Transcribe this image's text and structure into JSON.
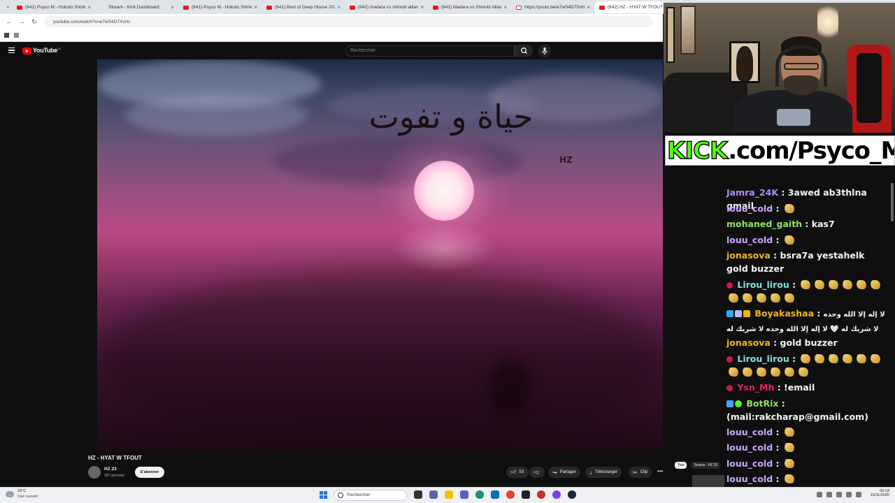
{
  "browser": {
    "tabs": [
      {
        "label": "(642) Psyco M - Hokuto Shinken",
        "icon": "youtube-icon"
      },
      {
        "label": "Stream - Kick Dashboard",
        "icon": "kick-icon"
      },
      {
        "label": "(641) Psyco M - Hokuto Shinken",
        "icon": "youtube-icon"
      },
      {
        "label": "(641) Best of Deep House 2023",
        "icon": "youtube-icon"
      },
      {
        "label": "(642) madara vs shinobi alliance",
        "icon": "youtube-icon"
      },
      {
        "label": "(642) Madara vs Shinobi Alliance",
        "icon": "youtube-icon"
      },
      {
        "label": "https://youtu.be/e7wS4D7XvHs",
        "icon": "gmail-icon"
      },
      {
        "label": "(642) HZ - HYAT W TFOUT",
        "icon": "youtube-icon"
      }
    ],
    "url": "youtube.com/watch?v=e7wS4D7XvHs"
  },
  "youtube": {
    "brand": "YouTube",
    "brand_suffix": "TN",
    "search_placeholder": "Rechercher",
    "video": {
      "overlay_title": "حياة و تفوت",
      "overlay_signature": "HZ",
      "title": "HZ - HYAT W TFOUT",
      "channel": "HZ 23",
      "subscribers": "187 abonnés",
      "subscribe_label": "S'abonner",
      "likes": "53",
      "share_label": "Partager",
      "download_label": "Télécharger",
      "clip_label": "Clip"
    },
    "recommendations": {
      "chip_all": "Tout",
      "chip_source": "Source : HZ 23"
    }
  },
  "stream_overlay": {
    "kick_brand": "KICK",
    "kick_url": ".com/Psyco_M",
    "chat": [
      {
        "user": "Jamra_24K",
        "color": "#b18cff",
        "text": "3awed ab3thlna gmail"
      },
      {
        "user": "louu_cold",
        "color": "#c9a8ff",
        "text": "",
        "emote": true
      },
      {
        "user": "mohaned_gaith",
        "color": "#8ee36a",
        "text": "kas7"
      },
      {
        "user": "louu_cold",
        "color": "#c9a8ff",
        "text": "",
        "emote": true
      },
      {
        "user": "jonasova",
        "color": "#f0b429",
        "text": "bsra7a yestahelk gold buzzer"
      },
      {
        "user": "Lirou_lirou",
        "color": "#7fe3e0",
        "text": "",
        "emote_count": 11
      },
      {
        "user": "Boyakashaa",
        "color": "#f0b429",
        "text": "لا إله إلا الله وحده لا شريك له 🤍 لا إله إلا الله وحده لا شريك له"
      },
      {
        "user": "jonasova",
        "color": "#f0b429",
        "text": "gold buzzer"
      },
      {
        "user": "Lirou_lirou",
        "color": "#7fe3e0",
        "text": "",
        "emote_count": 12
      },
      {
        "user": "Ysn_Mh",
        "color": "#e0245e",
        "text": "!email"
      },
      {
        "user": "BotRix",
        "color": "#8ee36a",
        "text": "(mail:rakcharap@gmail.com)"
      },
      {
        "user": "louu_cold",
        "color": "#c9a8ff",
        "text": "",
        "emote": true
      },
      {
        "user": "louu_cold",
        "color": "#c9a8ff",
        "text": "",
        "emote": true
      },
      {
        "user": "louu_cold",
        "color": "#c9a8ff",
        "text": "",
        "emote": true
      },
      {
        "user": "louu_cold",
        "color": "#c9a8ff",
        "text": "",
        "emote": true
      }
    ]
  },
  "taskbar": {
    "temperature": "18°C",
    "weather": "Ciel couvert",
    "search_placeholder": "Rechercher",
    "time": "00:18",
    "date": "15/11/2025"
  }
}
